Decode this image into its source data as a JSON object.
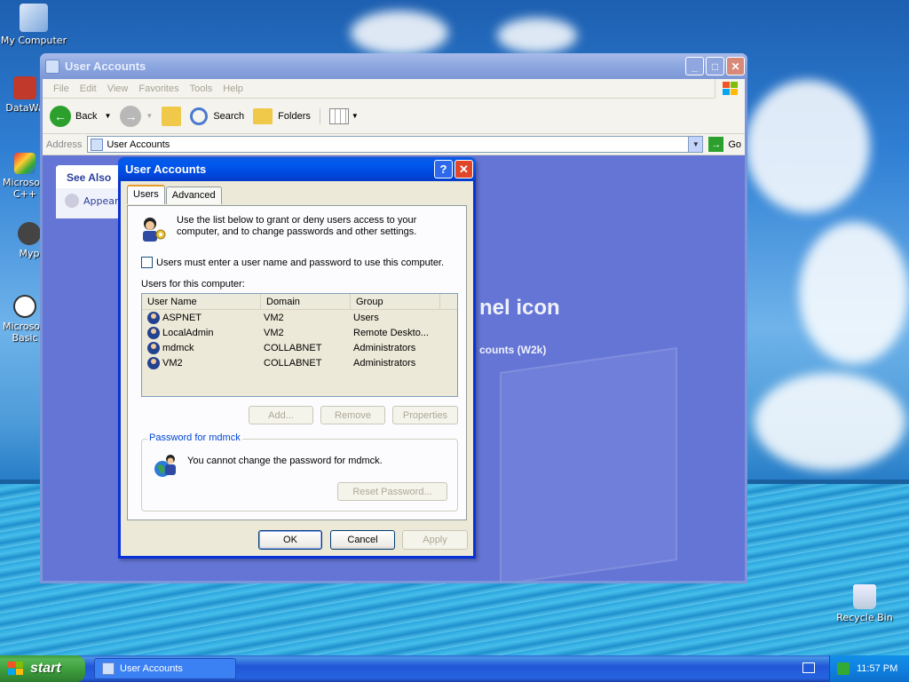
{
  "desktop": {
    "icons": [
      {
        "label": "My Computer"
      },
      {
        "label": "DataWa"
      },
      {
        "label": "Microsoft C++"
      },
      {
        "label": "Myp"
      },
      {
        "label": "Microsoft Basic"
      },
      {
        "label": "Recycle Bin"
      }
    ]
  },
  "explorer": {
    "title": "User Accounts",
    "menu": [
      "File",
      "Edit",
      "View",
      "Favorites",
      "Tools",
      "Help"
    ],
    "toolbar": {
      "back": "Back",
      "search": "Search",
      "folders": "Folders"
    },
    "address": {
      "label": "Address",
      "value": "User Accounts",
      "go": "Go"
    },
    "see_also": {
      "header": "See Also",
      "item": "Appear"
    },
    "background_title": "nel icon",
    "background_subtitle": "counts (W2k)"
  },
  "dialog": {
    "title": "User Accounts",
    "help": "?",
    "close": "✕",
    "tabs": [
      "Users",
      "Advanced"
    ],
    "intro": "Use the list below to grant or deny users access to your computer, and to change passwords and other settings.",
    "checkbox_label": "Users must enter a user name and password to use this computer.",
    "checkbox_checked": false,
    "list_label": "Users for this computer:",
    "columns": [
      "User Name",
      "Domain",
      "Group"
    ],
    "rows": [
      {
        "name": "ASPNET",
        "domain": "VM2",
        "group": "Users"
      },
      {
        "name": "LocalAdmin",
        "domain": "VM2",
        "group": "Remote Deskto..."
      },
      {
        "name": "mdmck",
        "domain": "COLLABNET",
        "group": "Administrators"
      },
      {
        "name": "VM2",
        "domain": "COLLABNET",
        "group": "Administrators"
      }
    ],
    "buttons": {
      "add": "Add...",
      "remove": "Remove",
      "properties": "Properties"
    },
    "password_group": {
      "legend": "Password for mdmck",
      "message": "You cannot change the password for mdmck.",
      "reset": "Reset Password..."
    },
    "footer": {
      "ok": "OK",
      "cancel": "Cancel",
      "apply": "Apply"
    }
  },
  "taskbar": {
    "start": "start",
    "task": "User Accounts",
    "clock": "11:57 PM"
  }
}
